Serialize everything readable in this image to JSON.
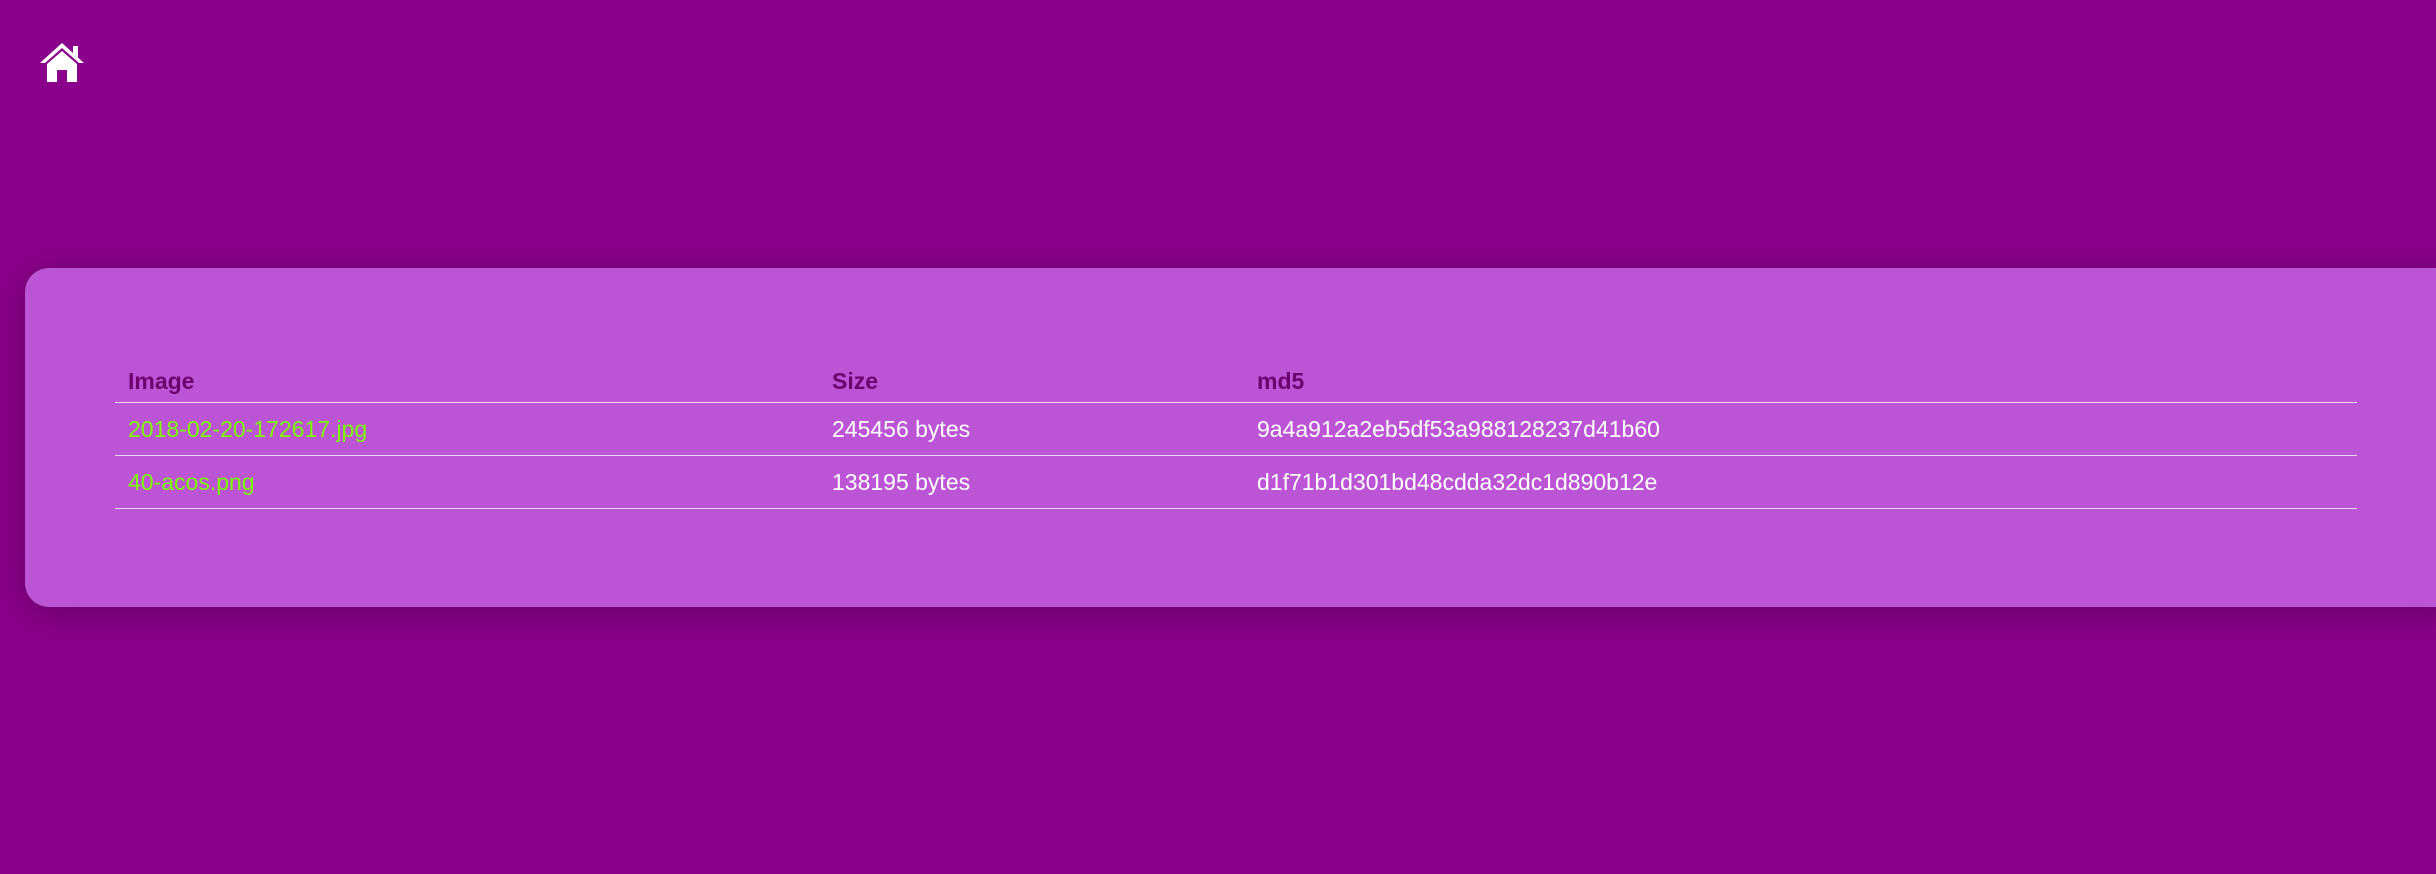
{
  "nav": {
    "home_icon": "home-icon",
    "icon_color": "#ffffff"
  },
  "colors": {
    "background": "#8b008b",
    "panel": "#bb55d5",
    "header_text": "#6e0070",
    "link": "#7cfc00",
    "cell_text": "#ffffff"
  },
  "table": {
    "headers": {
      "image": "Image",
      "size": "Size",
      "md5": "md5"
    },
    "rows": [
      {
        "image": "2018-02-20-172617.jpg",
        "size": "245456 bytes",
        "md5": "9a4a912a2eb5df53a988128237d41b60"
      },
      {
        "image": "40-acos.png",
        "size": "138195 bytes",
        "md5": "d1f71b1d301bd48cdda32dc1d890b12e"
      }
    ]
  }
}
